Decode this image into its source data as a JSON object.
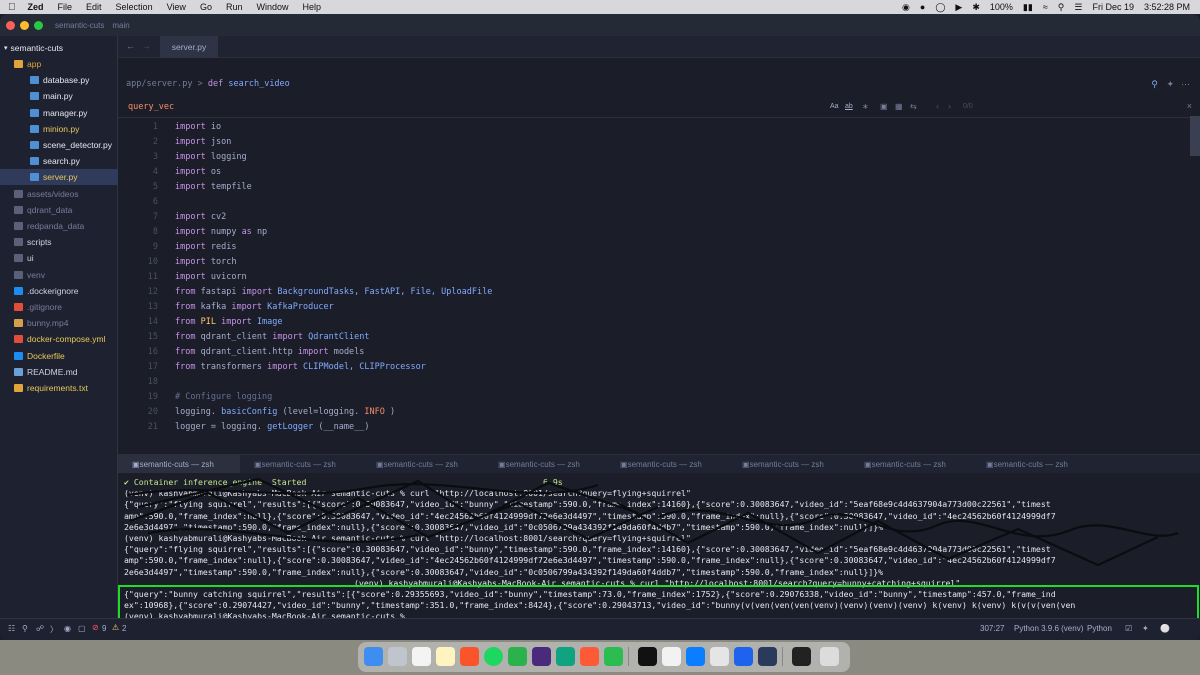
{
  "menubar": {
    "app": "Zed",
    "items": [
      "File",
      "Edit",
      "Selection",
      "View",
      "Go",
      "Run",
      "Window",
      "Help"
    ],
    "battery": "100%",
    "date": "Fri Dec 19",
    "time": "3:52:28 PM"
  },
  "window": {
    "title": "semantic-cuts",
    "branch": "main"
  },
  "sidebar": {
    "root": "semantic-cuts",
    "items": [
      {
        "label": "app",
        "kind": "folder-open",
        "color": "#e0a43a"
      },
      {
        "label": "database.py",
        "kind": "py",
        "color": "#e6e8f0"
      },
      {
        "label": "main.py",
        "kind": "py",
        "color": "#e6e8f0"
      },
      {
        "label": "manager.py",
        "kind": "py",
        "color": "#e6e8f0"
      },
      {
        "label": "minion.py",
        "kind": "py",
        "color": "#e8c85a"
      },
      {
        "label": "scene_detector.py",
        "kind": "py",
        "color": "#e6e8f0"
      },
      {
        "label": "search.py",
        "kind": "py",
        "color": "#e6e8f0"
      },
      {
        "label": "server.py",
        "kind": "py",
        "color": "#e8c85a",
        "selected": true
      },
      {
        "label": "assets/videos",
        "kind": "folder",
        "color": "#767c9d"
      },
      {
        "label": "qdrant_data",
        "kind": "folder",
        "color": "#767c9d"
      },
      {
        "label": "redpanda_data",
        "kind": "folder",
        "color": "#767c9d"
      },
      {
        "label": "scripts",
        "kind": "folder",
        "color": "#cfd2e0"
      },
      {
        "label": "ui",
        "kind": "folder",
        "color": "#cfd2e0"
      },
      {
        "label": "venv",
        "kind": "folder",
        "color": "#767c9d"
      },
      {
        "label": ".dockerignore",
        "kind": "docker",
        "color": "#cfd2e0"
      },
      {
        "label": ".gitignore",
        "kind": "git",
        "color": "#767c9d"
      },
      {
        "label": "bunny.mp4",
        "kind": "video",
        "color": "#767c9d"
      },
      {
        "label": "docker-compose.yml",
        "kind": "yml",
        "color": "#e8c85a"
      },
      {
        "label": "Dockerfile",
        "kind": "docker",
        "color": "#e8c85a"
      },
      {
        "label": "README.md",
        "kind": "md",
        "color": "#cfd2e0"
      },
      {
        "label": "requirements.txt",
        "kind": "txt",
        "color": "#e8c85a"
      }
    ]
  },
  "editor": {
    "tab": "server.py",
    "breadcrumb_path": "app/server.py",
    "breadcrumb_sep": " > ",
    "breadcrumb_kw": "def",
    "breadcrumb_fn": "search_video",
    "search_query": "query_vec",
    "search_count": "0/0",
    "search_opts": [
      "Aa",
      "ab"
    ],
    "lines": [
      [
        [
          "k",
          "import"
        ],
        [
          "",
          "io"
        ]
      ],
      [
        [
          "k",
          "import"
        ],
        [
          "",
          "json"
        ]
      ],
      [
        [
          "k",
          "import"
        ],
        [
          "",
          "logging"
        ]
      ],
      [
        [
          "k",
          "import"
        ],
        [
          "",
          "os"
        ]
      ],
      [
        [
          "k",
          "import"
        ],
        [
          "",
          "tempfile"
        ]
      ],
      [],
      [
        [
          "k",
          "import"
        ],
        [
          "",
          "cv2"
        ]
      ],
      [
        [
          "k",
          "import"
        ],
        [
          "",
          "numpy"
        ],
        [
          "k",
          "as"
        ],
        [
          "",
          "np"
        ]
      ],
      [
        [
          "k",
          "import"
        ],
        [
          "",
          "redis"
        ]
      ],
      [
        [
          "k",
          "import"
        ],
        [
          "",
          "torch"
        ]
      ],
      [
        [
          "k",
          "import"
        ],
        [
          "",
          "uvicorn"
        ]
      ],
      [
        [
          "k",
          "from"
        ],
        [
          "",
          "fastapi"
        ],
        [
          "k",
          "import"
        ],
        [
          "t",
          "BackgroundTasks, FastAPI, File, UploadFile"
        ]
      ],
      [
        [
          "k",
          "from"
        ],
        [
          "",
          "kafka"
        ],
        [
          "k",
          "import"
        ],
        [
          "t",
          "KafkaProducer"
        ]
      ],
      [
        [
          "k",
          "from"
        ],
        [
          "s",
          "PIL"
        ],
        [
          "k",
          "import"
        ],
        [
          "t",
          "Image"
        ]
      ],
      [
        [
          "k",
          "from"
        ],
        [
          "",
          "qdrant_client"
        ],
        [
          "k",
          "import"
        ],
        [
          "t",
          "QdrantClient"
        ]
      ],
      [
        [
          "k",
          "from"
        ],
        [
          "",
          "qdrant_client.http"
        ],
        [
          "k",
          "import"
        ],
        [
          "",
          "models"
        ]
      ],
      [
        [
          "k",
          "from"
        ],
        [
          "",
          "transformers"
        ],
        [
          "k",
          "import"
        ],
        [
          "t",
          "CLIPModel, CLIPProcessor"
        ]
      ],
      [],
      [
        [
          "c",
          "# Configure logging"
        ]
      ],
      [
        [
          "",
          "logging."
        ],
        [
          "f",
          "basicConfig"
        ],
        [
          "",
          "(level=logging."
        ],
        [
          "o",
          "INFO"
        ],
        [
          "",
          ")"
        ]
      ],
      [
        [
          "",
          "logger = logging."
        ],
        [
          "f",
          "getLogger"
        ],
        [
          "",
          "(__name__)"
        ]
      ]
    ]
  },
  "terminal": {
    "tabs": [
      "semantic-cuts — zsh",
      "semantic-cuts — zsh",
      "semantic-cuts — zsh",
      "semantic-cuts — zsh",
      "semantic-cuts — zsh",
      "semantic-cuts — zsh",
      "semantic-cuts — zsh",
      "semantic-cuts — zsh"
    ],
    "lines": [
      "✔ Container inference_engine  Started                                                6.9s",
      "(venv) kashyabmurali@Kashyabs-MacBook-Air semantic-cuts % curl \"http://localhost:8001/search?query=flying+squirrel\"",
      "{\"query\":\"flying squirrel\",\"results\":[{\"score\":0.30083647,\"video_id\":\"bunny\",\"timestamp\":590.0,\"frame_index\":14160},{\"score\":0.30083647,\"video_id\":\"5eaf68e9c4d4637904a773d00c22561\",\"timest",
      "amp\":590.0,\"frame_index\":null},{\"score\":0.30083647,\"video_id\":\"4ec24562b60f4124999df72e6e3d4497\",\"timestamp\":590.0,\"frame_index\":null},{\"score\":0.30083647,\"video_id\":\"4ec24562b60f4124999df7",
      "2e6e3d4497\",\"timestamp\":590.0,\"frame_index\":null},{\"score\":0.30083647,\"video_id\":\"0c0506799a434392f149da60f4ddb7\",\"timestamp\":590.0,\"frame_index\":null}]}%",
      "(venv) kashyabmurali@Kashyabs-MacBook-Air semantic-cuts % curl \"http://localhost:8001/search?query=flying+squirrel\"",
      "{\"query\":\"flying squirrel\",\"results\":[{\"score\":0.30083647,\"video_id\":\"bunny\",\"timestamp\":590.0,\"frame_index\":14160},{\"score\":0.30083647,\"video_id\":\"5eaf68e9c4d4637904a773d00c22561\",\"timest",
      "amp\":590.0,\"frame_index\":null},{\"score\":0.30083647,\"video_id\":\"4ec24562b60f4124999df72e6e3d4497\",\"timestamp\":590.0,\"frame_index\":null},{\"score\":0.30083647,\"video_id\":\"4ec24562b60f4124999df7",
      "2e6e3d4497\",\"timestamp\":590.0,\"frame_index\":null},{\"score\":0.30083647,\"video_id\":\"0c0506799a434392f149da60f4ddb7\",\"timestamp\":590.0,\"frame_index\":null}]}%",
      "(venv) kashyabmurali@Kashyabs-MacBook-Air semantic-cuts % curl \"http://localhost:8001/search?query=bunny+catching+squirrel\"",
      "{\"query\":\"bunny catching squirrel\",\"results\":[{\"score\":0.29355693,\"video_id\":\"bunny\",\"timestamp\":73.0,\"frame_index\":1752},{\"score\":0.29076338,\"video_id\":\"bunny\",\"timestamp\":457.0,\"frame_ind",
      "ex\":10968},{\"score\":0.29074427,\"video_id\":\"bunny\",\"timestamp\":351.0,\"frame_index\":8424},{\"score\":0.29043713,\"video_id\":\"bunny(v(ven(ven(ven(venv)(venv)(venv)(venv) k(venv) k(venv) k(v(v(ven(ven",
      "(venv) kashyabmurali@Kashyabs-MacBook-Air semantic-cuts % "
    ]
  },
  "statusbar": {
    "problems_errors": "9",
    "problems_warnings": "2",
    "cursor": "307:27",
    "interpreter": "Python 3.9.6 (venv)",
    "language": "Python"
  },
  "colors": {
    "highlight": "#1edc2a",
    "keyword": "#c792ea",
    "type": "#82aaff"
  }
}
